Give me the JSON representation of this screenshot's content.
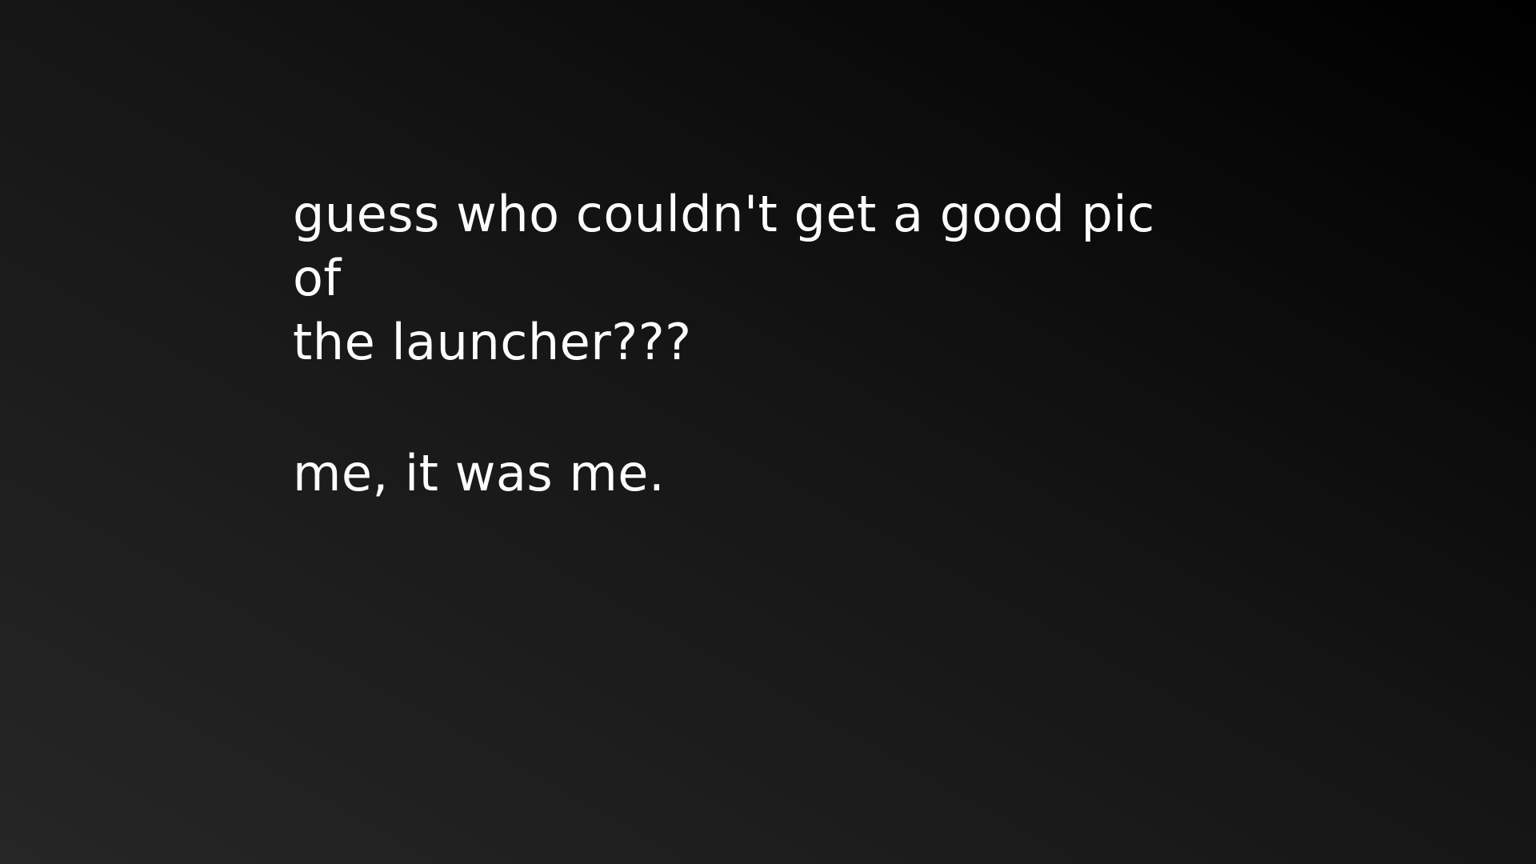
{
  "slide": {
    "line1": "guess who couldn't get a good pic of",
    "line2": "the launcher???",
    "line3": "me, it was me."
  },
  "colors": {
    "background_start": "#262626",
    "background_end": "#000000",
    "text": "#ffffff"
  }
}
